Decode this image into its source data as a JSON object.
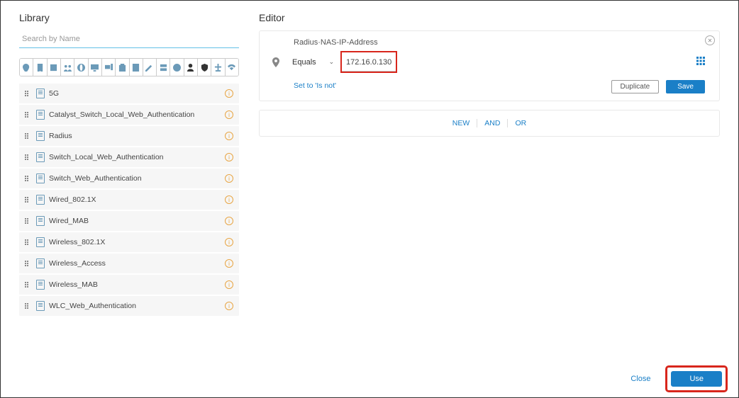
{
  "library": {
    "title": "Library",
    "search_placeholder": "Search by Name",
    "toolbar_icons": [
      "pin-icon",
      "bookmark-icon",
      "square-icon",
      "people-icon",
      "globe-icon",
      "monitor-icon",
      "devices-icon",
      "clipboard-icon",
      "note-icon",
      "edit-icon",
      "server-icon",
      "clock-icon",
      "person-icon",
      "shield-icon",
      "tree-icon",
      "wifi-icon"
    ],
    "items": [
      "5G",
      "Catalyst_Switch_Local_Web_Authentication",
      "Radius",
      "Switch_Local_Web_Authentication",
      "Switch_Web_Authentication",
      "Wired_802.1X",
      "Wired_MAB",
      "Wireless_802.1X",
      "Wireless_Access",
      "Wireless_MAB",
      "WLC_Web_Authentication"
    ]
  },
  "editor": {
    "title": "Editor",
    "attribute": "Radius·NAS-IP-Address",
    "operator": "Equals",
    "value": "172.16.0.130",
    "set_to_isnot": "Set to 'Is not'",
    "duplicate": "Duplicate",
    "save": "Save",
    "logic_new": "NEW",
    "logic_and": "AND",
    "logic_or": "OR"
  },
  "footer": {
    "close": "Close",
    "use": "Use"
  }
}
